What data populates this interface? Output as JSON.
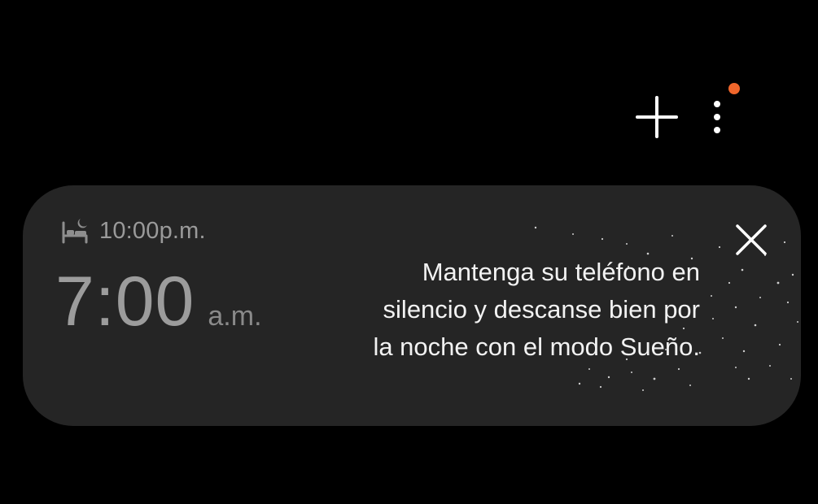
{
  "toolbar": {
    "add_icon": "plus-icon",
    "more_icon": "more-vertical-icon",
    "notification_dot_color": "#f0662b"
  },
  "sleep_card": {
    "bedtime_icon": "bed-moon-icon",
    "bedtime": "10:00p.m.",
    "wake_time": "7:00",
    "wake_period": "a.m.",
    "message_lines": [
      "Mantenga su teléfono en",
      "silencio y descanse bien por",
      "la noche con el modo Sueño."
    ],
    "close_icon": "close-icon"
  }
}
